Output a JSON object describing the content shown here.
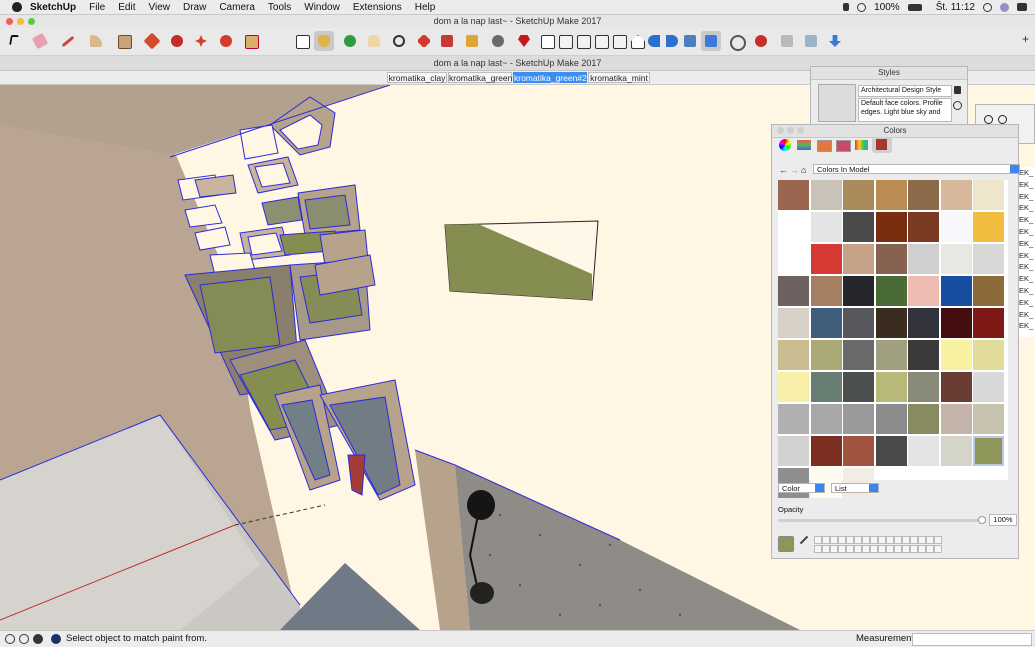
{
  "menubar": {
    "app": "SketchUp",
    "items": [
      "File",
      "Edit",
      "View",
      "Draw",
      "Camera",
      "Tools",
      "Window",
      "Extensions",
      "Help"
    ],
    "battery": "100%",
    "clock": "Št. 11:12"
  },
  "window": {
    "title": "dom a la nap last~ - SketchUp Make 2017",
    "doc_title": "dom a la nap last~ - SketchUp Make 2017"
  },
  "scene_tabs": [
    {
      "label": "kromatika_clay",
      "active": false
    },
    {
      "label": "kromatika_green",
      "active": false
    },
    {
      "label": "kromatika_green#2",
      "active": true
    },
    {
      "label": "kromatika_mint",
      "active": false
    }
  ],
  "styles_panel": {
    "title": "Styles",
    "style_name": "Architectural Design Style",
    "style_desc": "Default face colors. Profile edges. Light blue sky and"
  },
  "colors_panel": {
    "title": "Colors",
    "library": "Colors In Model",
    "swatches": [
      "#9a6650",
      "#c9c2b7",
      "#a98a5a",
      "#b88c52",
      "#8a6a48",
      "#d8b89a",
      "#efe4cc",
      "#ffffff",
      "#e4e4e4",
      "#4a4a4a",
      "#7a2e10",
      "#7b3a22",
      "#f8f8fc",
      "#f2bc3e",
      "#ffffff",
      "#d63a35",
      "#c6a288",
      "#876250",
      "#cfcfcf",
      "#e7e7e3",
      "#d8d8d6",
      "#6d6260",
      "#a67f62",
      "#26272c",
      "#4a6a36",
      "#efbcb4",
      "#174ea0",
      "#8c6a3a",
      "#d6d0c7",
      "#3e5e7c",
      "#56585c",
      "#3a2c1f",
      "#33333d",
      "#440e10",
      "#7e1a16",
      "#c8bc90",
      "#aaa874",
      "#6a6a6a",
      "#a0a080",
      "#3a3a3a",
      "#f8f2a0",
      "#e2dc9c",
      "#f8f0a8",
      "#687e72",
      "#4c514f",
      "#b8b878",
      "#8a8a7a",
      "#6a3c34",
      "#d8d8d8",
      "#b0b0b0",
      "#a8a8a8",
      "#9a9a9a",
      "#8c8c8c",
      "#888a60",
      "#c4b4aa",
      "#c8c2b0",
      "#d2d2d0",
      "#7c2e20",
      "#a15540",
      "#4a4a4a",
      "#e4e4e4",
      "#d4d4c8",
      "#8f965a",
      "#8e8e8e",
      "#fffaee",
      "#f2ece2"
    ],
    "color_mode": "Color",
    "list_mode": "List",
    "opacity_label": "Opacity",
    "opacity_value": "100%",
    "opacity_fraction": 1.0,
    "current_color": "#8f965a"
  },
  "right_list": [
    "EK_",
    "EK_",
    "EK_",
    "EK_",
    "EK_",
    "EK_",
    "EK_",
    "EK_",
    "EK_",
    "EK_",
    "EK_",
    "EK_",
    "EK_",
    "EK_"
  ],
  "status": {
    "message": "Select object to match paint from.",
    "measurements_label": "Measurements"
  },
  "colors": {
    "wall": "#b9a592",
    "floor": "#f9ecd8",
    "selection_edge": "#2b2bdc",
    "accent_green": "#868d51"
  }
}
